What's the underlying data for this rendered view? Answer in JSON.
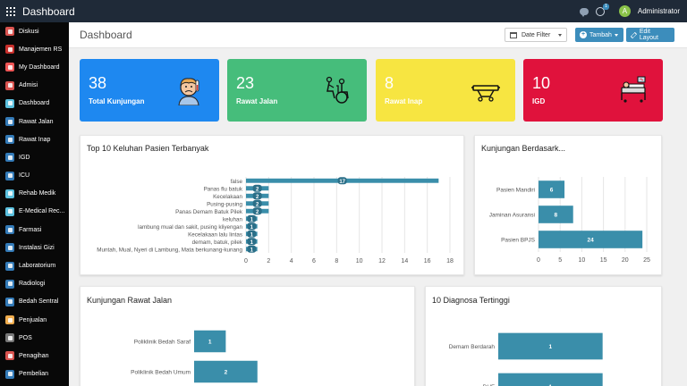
{
  "topbar": {
    "title": "Dashboard",
    "notification_count": "1",
    "avatar_initial": "A",
    "user_name": "Administrator"
  },
  "sidebar": {
    "items": [
      {
        "label": "Diskusi",
        "color": "#d9534f"
      },
      {
        "label": "Manajemen RS",
        "color": "#c9302c"
      },
      {
        "label": "My Dashboard",
        "color": "#e55"
      },
      {
        "label": "Admisi",
        "color": "#d9534f"
      },
      {
        "label": "Dashboard",
        "color": "#5bc0de"
      },
      {
        "label": "Rawat Jalan",
        "color": "#337ab7"
      },
      {
        "label": "Rawat Inap",
        "color": "#337ab7"
      },
      {
        "label": "IGD",
        "color": "#337ab7"
      },
      {
        "label": "ICU",
        "color": "#337ab7"
      },
      {
        "label": "Rehab Medik",
        "color": "#5bc0de"
      },
      {
        "label": "E-Medical Rec...",
        "color": "#5bc0de"
      },
      {
        "label": "Farmasi",
        "color": "#337ab7"
      },
      {
        "label": "Instalasi Gizi",
        "color": "#337ab7"
      },
      {
        "label": "Laboratorium",
        "color": "#337ab7"
      },
      {
        "label": "Radiologi",
        "color": "#337ab7"
      },
      {
        "label": "Bedah Sentral",
        "color": "#337ab7"
      },
      {
        "label": "Penjualan",
        "color": "#f0ad4e"
      },
      {
        "label": "POS",
        "color": "#777"
      },
      {
        "label": "Penagihan",
        "color": "#d9534f"
      },
      {
        "label": "Pembelian",
        "color": "#337ab7"
      }
    ]
  },
  "header": {
    "title": "Dashboard",
    "date_filter": "Date Filter",
    "tambah": "Tambah",
    "edit_layout": "Edit Layout"
  },
  "cards": [
    {
      "value": "38",
      "label": "Total Kunjungan",
      "color": "#1e88f0",
      "icon": "sick-person-icon"
    },
    {
      "value": "23",
      "label": "Rawat Jalan",
      "color": "#46bd7b",
      "icon": "wheelchair-icon"
    },
    {
      "value": "8",
      "label": "Rawat Inap",
      "color": "#f7e541",
      "icon": "stretcher-icon"
    },
    {
      "value": "10",
      "label": "IGD",
      "color": "#e0123c",
      "icon": "hospital-bed-icon"
    }
  ],
  "panels": {
    "keluhan": "Top 10 Keluhan Pasien Terbanyak",
    "kunjungan": "Kunjungan Berdasark...",
    "rawat_jalan": "Kunjungan Rawat Jalan",
    "diagnosa": "10 Diagnosa Tertinggi"
  },
  "chart_data": [
    {
      "type": "bar",
      "orientation": "horizontal",
      "title": "Top 10 Keluhan Pasien Terbanyak",
      "categories": [
        "false",
        "Panas flu batuk",
        "Kecelakaan",
        "Pusing-pusing",
        "Panas  Demam  Batuk Pilek",
        "keluhan",
        "lambung mual dan sakit, pusing kliyengan",
        "Kecelakaan lalu lintas",
        "demam, batuk, pilek",
        "Muntah, Mual, Nyeri di Lambung, Mata berkunang-kunang"
      ],
      "values": [
        17,
        2,
        2,
        2,
        2,
        1,
        1,
        1,
        1,
        1
      ],
      "xlim": [
        0,
        18
      ],
      "xticks": [
        0,
        2,
        4,
        6,
        8,
        10,
        12,
        14,
        16,
        18
      ],
      "color": "#3a8eaa"
    },
    {
      "type": "bar",
      "orientation": "horizontal",
      "title": "Kunjungan Berdasark...",
      "categories": [
        "Pasien Mandiri",
        "Jaminan Asuransi",
        "Pasien BPJS"
      ],
      "values": [
        6,
        8,
        24
      ],
      "xlim": [
        0,
        25
      ],
      "xticks": [
        0,
        5,
        10,
        15,
        20,
        25
      ],
      "color": "#3a8eaa"
    },
    {
      "type": "bar",
      "orientation": "horizontal",
      "title": "Kunjungan Rawat Jalan",
      "categories": [
        "Poliklinik Bedah Saraf",
        "Poliklinik Bedah Umum"
      ],
      "values": [
        1,
        2
      ],
      "color": "#3a8eaa"
    },
    {
      "type": "bar",
      "orientation": "horizontal",
      "title": "10 Diagnosa Tertinggi",
      "categories": [
        "Demam Berdarah",
        "DHF"
      ],
      "values": [
        1,
        1
      ],
      "color": "#3a8eaa"
    }
  ]
}
